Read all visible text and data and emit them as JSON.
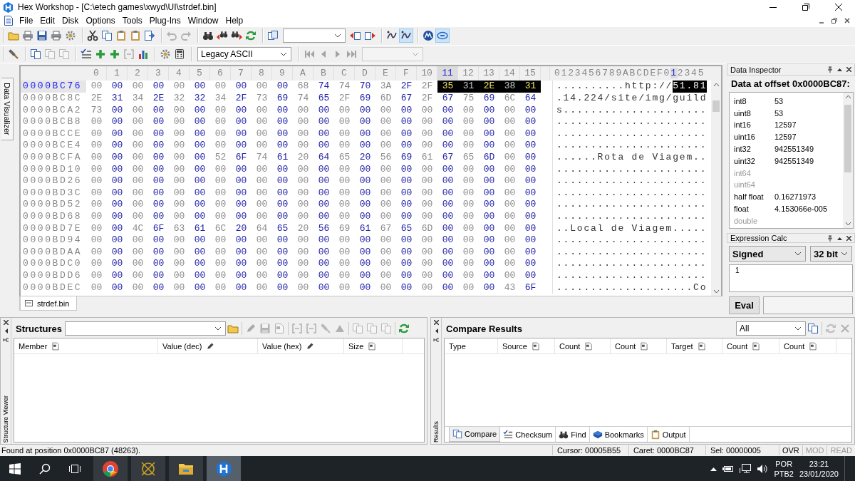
{
  "window": {
    "title": "Hex Workshop - [C:\\etech games\\xwyd\\UI\\strdef.bin]"
  },
  "menu": [
    "File",
    "Edit",
    "Disk",
    "Options",
    "Tools",
    "Plug-Ins",
    "Window",
    "Help"
  ],
  "toolbar_1": [
    {
      "buttons": [
        {
          "kind": "folder",
          "disabled": false,
          "pressed": false
        },
        {
          "kind": "printer",
          "disabled": false,
          "pressed": false
        },
        {
          "kind": "disk",
          "disabled": false,
          "pressed": false
        },
        {
          "kind": "printer",
          "disabled": false,
          "pressed": false
        },
        {
          "kind": "gear",
          "disabled": false,
          "pressed": false
        }
      ]
    },
    {
      "buttons": [
        {
          "kind": "scissors",
          "disabled": false,
          "pressed": false
        },
        {
          "kind": "copy",
          "disabled": false,
          "pressed": false
        },
        {
          "kind": "clipboard",
          "disabled": false,
          "pressed": false
        },
        {
          "kind": "clipboard",
          "disabled": false,
          "pressed": false
        },
        {
          "kind": "export",
          "disabled": false,
          "pressed": false
        }
      ]
    },
    {
      "buttons": [
        {
          "kind": "undo",
          "disabled": true,
          "pressed": false
        },
        {
          "kind": "redo",
          "disabled": true,
          "pressed": false
        }
      ]
    },
    {
      "buttons": [
        {
          "kind": "binoculars",
          "disabled": false,
          "pressed": false
        },
        {
          "kind": "findprev",
          "disabled": false,
          "pressed": false
        },
        {
          "kind": "findnext",
          "disabled": false,
          "pressed": false
        },
        {
          "kind": "refresh",
          "disabled": false,
          "pressed": false
        }
      ]
    },
    {
      "buttons": [
        {
          "kind": "goto",
          "disabled": false,
          "pressed": false
        },
        {
          "kind": "combo",
          "disabled": false
        },
        {
          "kind": "goback",
          "disabled": false,
          "pressed": false
        },
        {
          "kind": "gofwd",
          "disabled": false,
          "pressed": false
        }
      ]
    },
    {
      "buttons": [
        {
          "kind": "swirl",
          "disabled": false,
          "pressed": false
        },
        {
          "kind": "swirl",
          "disabled": false,
          "pressed": true
        }
      ]
    },
    {
      "buttons": [
        {
          "kind": "circlelogo",
          "disabled": false,
          "pressed": false
        },
        {
          "kind": "ovallogo",
          "disabled": false,
          "pressed": true
        }
      ]
    }
  ],
  "toolbar_2": [
    {
      "buttons": [
        {
          "kind": "hammer",
          "disabled": false,
          "pressed": false
        }
      ]
    },
    {
      "buttons": [
        {
          "kind": "copy",
          "disabled": false,
          "pressed": false
        },
        {
          "kind": "copy",
          "disabled": true,
          "pressed": false
        },
        {
          "kind": "copy",
          "disabled": true,
          "pressed": false
        }
      ]
    },
    {
      "buttons": [
        {
          "kind": "checklist",
          "disabled": false,
          "pressed": false
        },
        {
          "kind": "plus",
          "disabled": false,
          "pressed": false
        },
        {
          "kind": "plus",
          "disabled": false,
          "pressed": false
        },
        {
          "kind": "brackets",
          "disabled": true,
          "pressed": false
        },
        {
          "kind": "chart",
          "disabled": false,
          "pressed": false
        }
      ]
    },
    {
      "buttons": [
        {
          "kind": "gear",
          "disabled": false,
          "pressed": false
        },
        {
          "kind": "calculator",
          "disabled": false,
          "pressed": false
        }
      ]
    },
    {
      "buttons": [
        {
          "kind": "combo",
          "disabled": false,
          "value": "Legacy ASCII"
        }
      ]
    },
    {
      "buttons": [
        {
          "kind": "first",
          "disabled": true,
          "pressed": false
        },
        {
          "kind": "prev",
          "disabled": true,
          "pressed": false
        },
        {
          "kind": "next",
          "disabled": true,
          "pressed": false
        },
        {
          "kind": "last",
          "disabled": true,
          "pressed": false
        },
        {
          "kind": "combo",
          "disabled": true
        }
      ]
    }
  ],
  "side_tab": {
    "label": "Data Visualizer"
  },
  "hex_view": {
    "columns": [
      {
        "label": "0",
        "selected": false
      },
      {
        "label": "1",
        "selected": false
      },
      {
        "label": "2",
        "selected": false
      },
      {
        "label": "3",
        "selected": false
      },
      {
        "label": "4",
        "selected": false
      },
      {
        "label": "5",
        "selected": false
      },
      {
        "label": "6",
        "selected": false
      },
      {
        "label": "7",
        "selected": false
      },
      {
        "label": "8",
        "selected": false
      },
      {
        "label": "9",
        "selected": false
      },
      {
        "label": "A",
        "selected": false
      },
      {
        "label": "B",
        "selected": false
      },
      {
        "label": "C",
        "selected": false
      },
      {
        "label": "D",
        "selected": false
      },
      {
        "label": "E",
        "selected": false
      },
      {
        "label": "F",
        "selected": false
      },
      {
        "label": "10",
        "selected": false
      },
      {
        "label": "11",
        "selected": true
      },
      {
        "label": "12",
        "selected": false
      },
      {
        "label": "13",
        "selected": false
      },
      {
        "label": "14",
        "selected": false
      },
      {
        "label": "15",
        "selected": false
      }
    ],
    "text_header": [
      {
        "text": "0123456789ABCDEF0",
        "selected": false
      },
      {
        "text": "1",
        "selected": true
      },
      {
        "text": "2345",
        "selected": false
      }
    ],
    "rows": [
      {
        "offset": "0000BC76",
        "selected": true,
        "bytes": [
          {
            "text": "00 00 00 00 00 00 00 00 00 00 68 74 74 70 3A 2F 2F",
            "selected": false
          },
          {
            "text": "35 31 2E 38 31",
            "selected": true
          }
        ],
        "text": [
          {
            "text": "..........http://",
            "selected": false
          },
          {
            "text": "51.81",
            "selected": true
          }
        ]
      },
      {
        "offset": "0000BC8C",
        "selected": false,
        "bytes": [
          {
            "text": "2E 31 34 2E 32 32 34 2F 73 69 74 65 2F 69 6D 67 2F 67 75 69 6C 64",
            "selected": false
          }
        ],
        "text": [
          {
            "text": ".14.224/site/img/guild",
            "selected": false
          }
        ]
      },
      {
        "offset": "0000BCA2",
        "selected": false,
        "bytes": [
          {
            "text": "73 00 00 00 00 00 00 00 00 00 00 00 00 00 00 00 00 00 00 00 00 00",
            "selected": false
          }
        ],
        "text": [
          {
            "text": "s.....................",
            "selected": false
          }
        ]
      },
      {
        "offset": "0000BCB8",
        "selected": false,
        "bytes": [
          {
            "text": "00 00 00 00 00 00 00 00 00 00 00 00 00 00 00 00 00 00 00 00 00 00",
            "selected": false
          }
        ],
        "text": [
          {
            "text": "......................",
            "selected": false
          }
        ]
      },
      {
        "offset": "0000BCCE",
        "selected": false,
        "bytes": [
          {
            "text": "00 00 00 00 00 00 00 00 00 00 00 00 00 00 00 00 00 00 00 00 00 00",
            "selected": false
          }
        ],
        "text": [
          {
            "text": "......................",
            "selected": false
          }
        ]
      },
      {
        "offset": "0000BCE4",
        "selected": false,
        "bytes": [
          {
            "text": "00 00 00 00 00 00 00 00 00 00 00 00 00 00 00 00 00 00 00 00 00 00",
            "selected": false
          }
        ],
        "text": [
          {
            "text": "......................",
            "selected": false
          }
        ]
      },
      {
        "offset": "0000BCFA",
        "selected": false,
        "bytes": [
          {
            "text": "00 00 00 00 00 00 52 6F 74 61 20 64 65 20 56 69 61 67 65 6D 00 00",
            "selected": false
          }
        ],
        "text": [
          {
            "text": "......Rota de Viagem..",
            "selected": false
          }
        ]
      },
      {
        "offset": "0000BD10",
        "selected": false,
        "bytes": [
          {
            "text": "00 00 00 00 00 00 00 00 00 00 00 00 00 00 00 00 00 00 00 00 00 00",
            "selected": false
          }
        ],
        "text": [
          {
            "text": "......................",
            "selected": false
          }
        ]
      },
      {
        "offset": "0000BD26",
        "selected": false,
        "bytes": [
          {
            "text": "00 00 00 00 00 00 00 00 00 00 00 00 00 00 00 00 00 00 00 00 00 00",
            "selected": false
          }
        ],
        "text": [
          {
            "text": "......................",
            "selected": false
          }
        ]
      },
      {
        "offset": "0000BD3C",
        "selected": false,
        "bytes": [
          {
            "text": "00 00 00 00 00 00 00 00 00 00 00 00 00 00 00 00 00 00 00 00 00 00",
            "selected": false
          }
        ],
        "text": [
          {
            "text": "......................",
            "selected": false
          }
        ]
      },
      {
        "offset": "0000BD52",
        "selected": false,
        "bytes": [
          {
            "text": "00 00 00 00 00 00 00 00 00 00 00 00 00 00 00 00 00 00 00 00 00 00",
            "selected": false
          }
        ],
        "text": [
          {
            "text": "......................",
            "selected": false
          }
        ]
      },
      {
        "offset": "0000BD68",
        "selected": false,
        "bytes": [
          {
            "text": "00 00 00 00 00 00 00 00 00 00 00 00 00 00 00 00 00 00 00 00 00 00",
            "selected": false
          }
        ],
        "text": [
          {
            "text": "......................",
            "selected": false
          }
        ]
      },
      {
        "offset": "0000BD7E",
        "selected": false,
        "bytes": [
          {
            "text": "00 00 4C 6F 63 61 6C 20 64 65 20 56 69 61 67 65 6D 00 00 00 00 00",
            "selected": false
          }
        ],
        "text": [
          {
            "text": "..Local de Viagem.....",
            "selected": false
          }
        ]
      },
      {
        "offset": "0000BD94",
        "selected": false,
        "bytes": [
          {
            "text": "00 00 00 00 00 00 00 00 00 00 00 00 00 00 00 00 00 00 00 00 00 00",
            "selected": false
          }
        ],
        "text": [
          {
            "text": "......................",
            "selected": false
          }
        ]
      },
      {
        "offset": "0000BDAA",
        "selected": false,
        "bytes": [
          {
            "text": "00 00 00 00 00 00 00 00 00 00 00 00 00 00 00 00 00 00 00 00 00 00",
            "selected": false
          }
        ],
        "text": [
          {
            "text": "......................",
            "selected": false
          }
        ]
      },
      {
        "offset": "0000BDC0",
        "selected": false,
        "bytes": [
          {
            "text": "00 00 00 00 00 00 00 00 00 00 00 00 00 00 00 00 00 00 00 00 00 00",
            "selected": false
          }
        ],
        "text": [
          {
            "text": "......................",
            "selected": false
          }
        ]
      },
      {
        "offset": "0000BDD6",
        "selected": false,
        "bytes": [
          {
            "text": "00 00 00 00 00 00 00 00 00 00 00 00 00 00 00 00 00 00 00 00 00 00",
            "selected": false
          }
        ],
        "text": [
          {
            "text": "......................",
            "selected": false
          }
        ]
      },
      {
        "offset": "0000BDEC",
        "selected": false,
        "bytes": [
          {
            "text": "00 00 00 00 00 00 00 00 00 00 00 00 00 00 00 00 00 00 00 00 43 6F",
            "selected": false
          }
        ],
        "text": [
          {
            "text": "....................Co",
            "selected": false
          }
        ]
      }
    ],
    "tabs": [
      {
        "label": "strdef.bin",
        "selected": true
      }
    ]
  },
  "data_inspector": {
    "title": "Data Inspector",
    "heading": "Data at offset 0x0000BC87:",
    "rows": [
      {
        "type": "int8",
        "value": "53",
        "disabled": false
      },
      {
        "type": "uint8",
        "value": "53",
        "disabled": false
      },
      {
        "type": "int16",
        "value": "12597",
        "disabled": false
      },
      {
        "type": "uint16",
        "value": "12597",
        "disabled": false
      },
      {
        "type": "int32",
        "value": "942551349",
        "disabled": false
      },
      {
        "type": "uint32",
        "value": "942551349",
        "disabled": false
      },
      {
        "type": "int64",
        "disabled": true
      },
      {
        "type": "uint64",
        "disabled": true
      },
      {
        "type": "half float",
        "value": "0.16271973",
        "disabled": false
      },
      {
        "type": "float",
        "value": "4.153066e-005",
        "disabled": false
      },
      {
        "type": "double",
        "disabled": true
      }
    ]
  },
  "expression_calc": {
    "title": "Expression Calc",
    "mode": "Signed",
    "width": "32 bit",
    "line_numbers": [
      "1"
    ],
    "button": "Eval"
  },
  "structures": {
    "title": "Structures",
    "side_label": "Structure Viewer",
    "toolbar": [
      {
        "kind": "folder",
        "disabled": false
      },
      {
        "kind": "pencil",
        "disabled": true
      },
      {
        "kind": "disk",
        "disabled": true
      },
      {
        "kind": "page",
        "disabled": true
      },
      {
        "kind": "brackets",
        "disabled": true
      },
      {
        "kind": "brackets",
        "disabled": true
      },
      {
        "kind": "hammer",
        "disabled": true
      },
      {
        "kind": "up",
        "disabled": true
      },
      {
        "kind": "copy",
        "disabled": true
      },
      {
        "kind": "copy",
        "disabled": true
      },
      {
        "kind": "copy",
        "disabled": true
      },
      {
        "kind": "refresh",
        "disabled": false
      }
    ],
    "columns": [
      {
        "label": "Member",
        "kind": "page"
      },
      {
        "label": "Value (dec)",
        "kind": "pencil"
      },
      {
        "label": "Value (hex)",
        "kind": "pencil"
      },
      {
        "label": "Size",
        "kind": "page"
      }
    ]
  },
  "compare": {
    "title": "Compare Results",
    "side_label": "Results",
    "filter": "All",
    "toolbar": [
      {
        "kind": "copy",
        "disabled": false
      },
      {
        "kind": "refresh",
        "disabled": true
      },
      {
        "kind": "x",
        "disabled": true
      }
    ],
    "columns": [
      {
        "label": "Type",
        "kind": "plain"
      },
      {
        "label": "Source",
        "kind": "page"
      },
      {
        "label": "Count",
        "kind": "page"
      },
      {
        "label": "Count",
        "kind": "page"
      },
      {
        "label": "Target",
        "kind": "page"
      },
      {
        "label": "Count",
        "kind": "page"
      },
      {
        "label": "Count",
        "kind": "page"
      }
    ],
    "tabs": [
      {
        "label": "Compare",
        "kind": "copy",
        "selected": true
      },
      {
        "label": "Checksum",
        "kind": "checklist",
        "selected": false
      },
      {
        "label": "Find",
        "kind": "binoculars",
        "selected": false
      },
      {
        "label": "Bookmarks",
        "kind": "book",
        "selected": false
      },
      {
        "label": "Output",
        "kind": "clipboard",
        "selected": false
      }
    ]
  },
  "status_bar": {
    "message": "Found at position 0x0000BC87 (48263).",
    "fields": [
      "Cursor: 00005B55",
      "Caret: 0000BC87",
      "Sel: 00000005"
    ],
    "indicators": [
      {
        "label": "OVR",
        "disabled": false
      },
      {
        "label": "MOD",
        "disabled": true
      },
      {
        "label": "READ",
        "disabled": true
      }
    ]
  },
  "taskbar": {
    "apps": [
      {
        "kind": "round",
        "selected": false
      },
      {
        "kind": "crosshair",
        "selected": false
      },
      {
        "kind": "folder",
        "selected": false
      },
      {
        "kind": "hexagon",
        "selected": true
      }
    ],
    "language": "POR",
    "layout": "PTB2",
    "time": "23:21",
    "date": "23/01/2020"
  }
}
